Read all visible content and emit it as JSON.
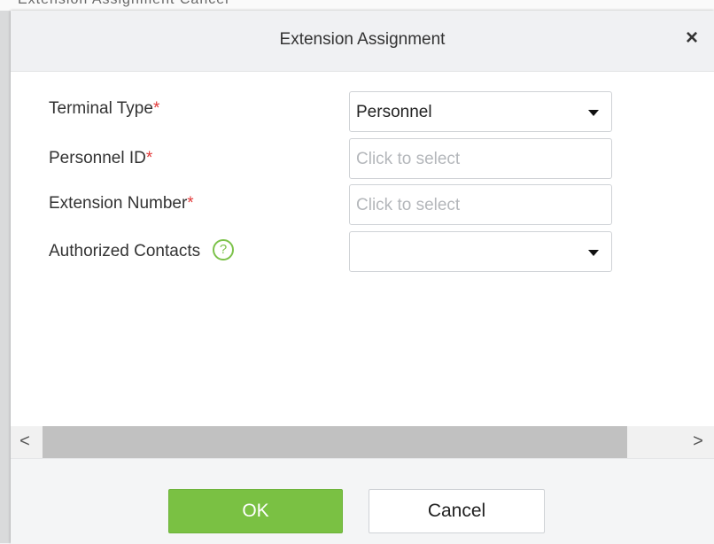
{
  "background": {
    "fragment_text": "Extension Assignment  Cancel"
  },
  "dialog": {
    "title": "Extension Assignment",
    "close_symbol": "×",
    "fields": {
      "terminal_type": {
        "label": "Terminal Type",
        "required_mark": "*",
        "value": "Personnel"
      },
      "personnel_id": {
        "label": "Personnel ID",
        "required_mark": "*",
        "placeholder": "Click to select"
      },
      "extension_number": {
        "label": "Extension Number",
        "required_mark": "*",
        "placeholder": "Click to select"
      },
      "authorized_contacts": {
        "label": "Authorized Contacts",
        "help_symbol": "?",
        "value": ""
      }
    },
    "scrollbar": {
      "left_arrow": "<",
      "right_arrow": ">"
    },
    "buttons": {
      "ok": "OK",
      "cancel": "Cancel"
    }
  },
  "colors": {
    "accent_green": "#7ac143",
    "required_red": "#e23a3a",
    "help_green": "#7cc24a"
  },
  "icons": [
    "close-icon",
    "chevron-down-icon",
    "help-icon",
    "chevron-left-icon",
    "chevron-right-icon"
  ]
}
